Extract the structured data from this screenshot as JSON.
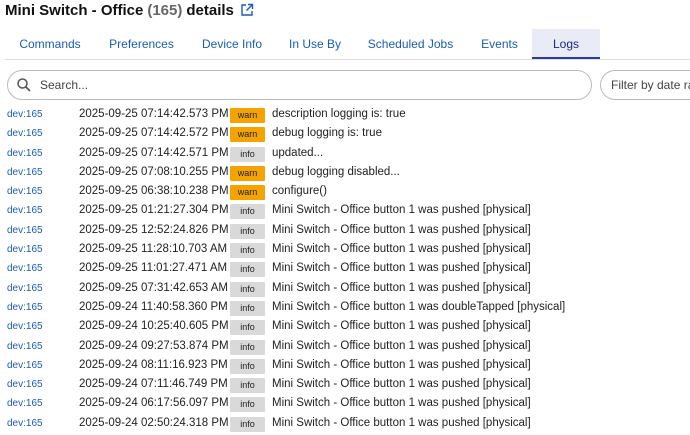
{
  "header": {
    "title": "Mini Switch - Office",
    "count": "(165)",
    "suffix": "details"
  },
  "tabs": [
    {
      "label": "Commands",
      "active": false
    },
    {
      "label": "Preferences",
      "active": false
    },
    {
      "label": "Device Info",
      "active": false
    },
    {
      "label": "In Use By",
      "active": false
    },
    {
      "label": "Scheduled Jobs",
      "active": false
    },
    {
      "label": "Events",
      "active": false
    },
    {
      "label": "Logs",
      "active": true
    }
  ],
  "search": {
    "placeholder": "Search..."
  },
  "filter": {
    "placeholder": "Filter by date range"
  },
  "colors": {
    "link": "#1c5cb5",
    "warn": "#f5a300",
    "info": "#d9d9d9",
    "active_tab_bg": "#e9ebf6"
  },
  "logs": [
    {
      "dev": "dev:165",
      "ts": "2025-09-25 07:14:42.573 PM",
      "level": "warn",
      "msg": "description logging is: true"
    },
    {
      "dev": "dev:165",
      "ts": "2025-09-25 07:14:42.572 PM",
      "level": "warn",
      "msg": "debug logging is: true"
    },
    {
      "dev": "dev:165",
      "ts": "2025-09-25 07:14:42.571 PM",
      "level": "info",
      "msg": "updated..."
    },
    {
      "dev": "dev:165",
      "ts": "2025-09-25 07:08:10.255 PM",
      "level": "warn",
      "msg": "debug logging disabled..."
    },
    {
      "dev": "dev:165",
      "ts": "2025-09-25 06:38:10.238 PM",
      "level": "warn",
      "msg": "configure()"
    },
    {
      "dev": "dev:165",
      "ts": "2025-09-25 01:21:27.304 PM",
      "level": "info",
      "msg": "Mini Switch - Office button 1 was pushed [physical]"
    },
    {
      "dev": "dev:165",
      "ts": "2025-09-25 12:52:24.826 PM",
      "level": "info",
      "msg": "Mini Switch - Office button 1 was pushed [physical]"
    },
    {
      "dev": "dev:165",
      "ts": "2025-09-25 11:28:10.703 AM",
      "level": "info",
      "msg": "Mini Switch - Office button 1 was pushed [physical]"
    },
    {
      "dev": "dev:165",
      "ts": "2025-09-25 11:01:27.471 AM",
      "level": "info",
      "msg": "Mini Switch - Office button 1 was pushed [physical]"
    },
    {
      "dev": "dev:165",
      "ts": "2025-09-25 07:31:42.653 AM",
      "level": "info",
      "msg": "Mini Switch - Office button 1 was pushed [physical]"
    },
    {
      "dev": "dev:165",
      "ts": "2025-09-24 11:40:58.360 PM",
      "level": "info",
      "msg": "Mini Switch - Office button 1 was doubleTapped [physical]"
    },
    {
      "dev": "dev:165",
      "ts": "2025-09-24 10:25:40.605 PM",
      "level": "info",
      "msg": "Mini Switch - Office button 1 was pushed [physical]"
    },
    {
      "dev": "dev:165",
      "ts": "2025-09-24 09:27:53.874 PM",
      "level": "info",
      "msg": "Mini Switch - Office button 1 was pushed [physical]"
    },
    {
      "dev": "dev:165",
      "ts": "2025-09-24 08:11:16.923 PM",
      "level": "info",
      "msg": "Mini Switch - Office button 1 was pushed [physical]"
    },
    {
      "dev": "dev:165",
      "ts": "2025-09-24 07:11:46.749 PM",
      "level": "info",
      "msg": "Mini Switch - Office button 1 was pushed [physical]"
    },
    {
      "dev": "dev:165",
      "ts": "2025-09-24 06:17:56.097 PM",
      "level": "info",
      "msg": "Mini Switch - Office button 1 was pushed [physical]"
    },
    {
      "dev": "dev:165",
      "ts": "2025-09-24 02:50:24.318 PM",
      "level": "info",
      "msg": "Mini Switch - Office button 1 was pushed [physical]"
    }
  ]
}
